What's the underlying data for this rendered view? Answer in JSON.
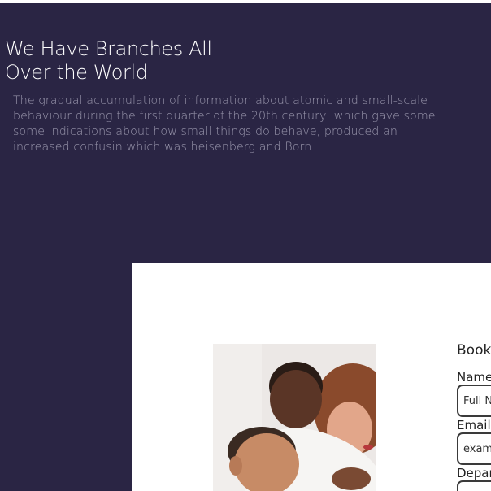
{
  "hero": {
    "title_line1": "We Have Branches All",
    "title_line2": "Over the World",
    "description": "The gradual accumulation of information about atomic and small-scale behaviour during the first quarter of the 20th century, which gave some some indications about how small things do behave, produced an increased confusin which was heisenberg and Born."
  },
  "booking": {
    "title": "Book",
    "name_label": "Name",
    "name_placeholder": "Full N",
    "email_label": "Email",
    "email_placeholder": "exam",
    "department_label": "Depar"
  },
  "colors": {
    "hero_bg": "#2a2544",
    "card_bg": "#ffffff"
  }
}
